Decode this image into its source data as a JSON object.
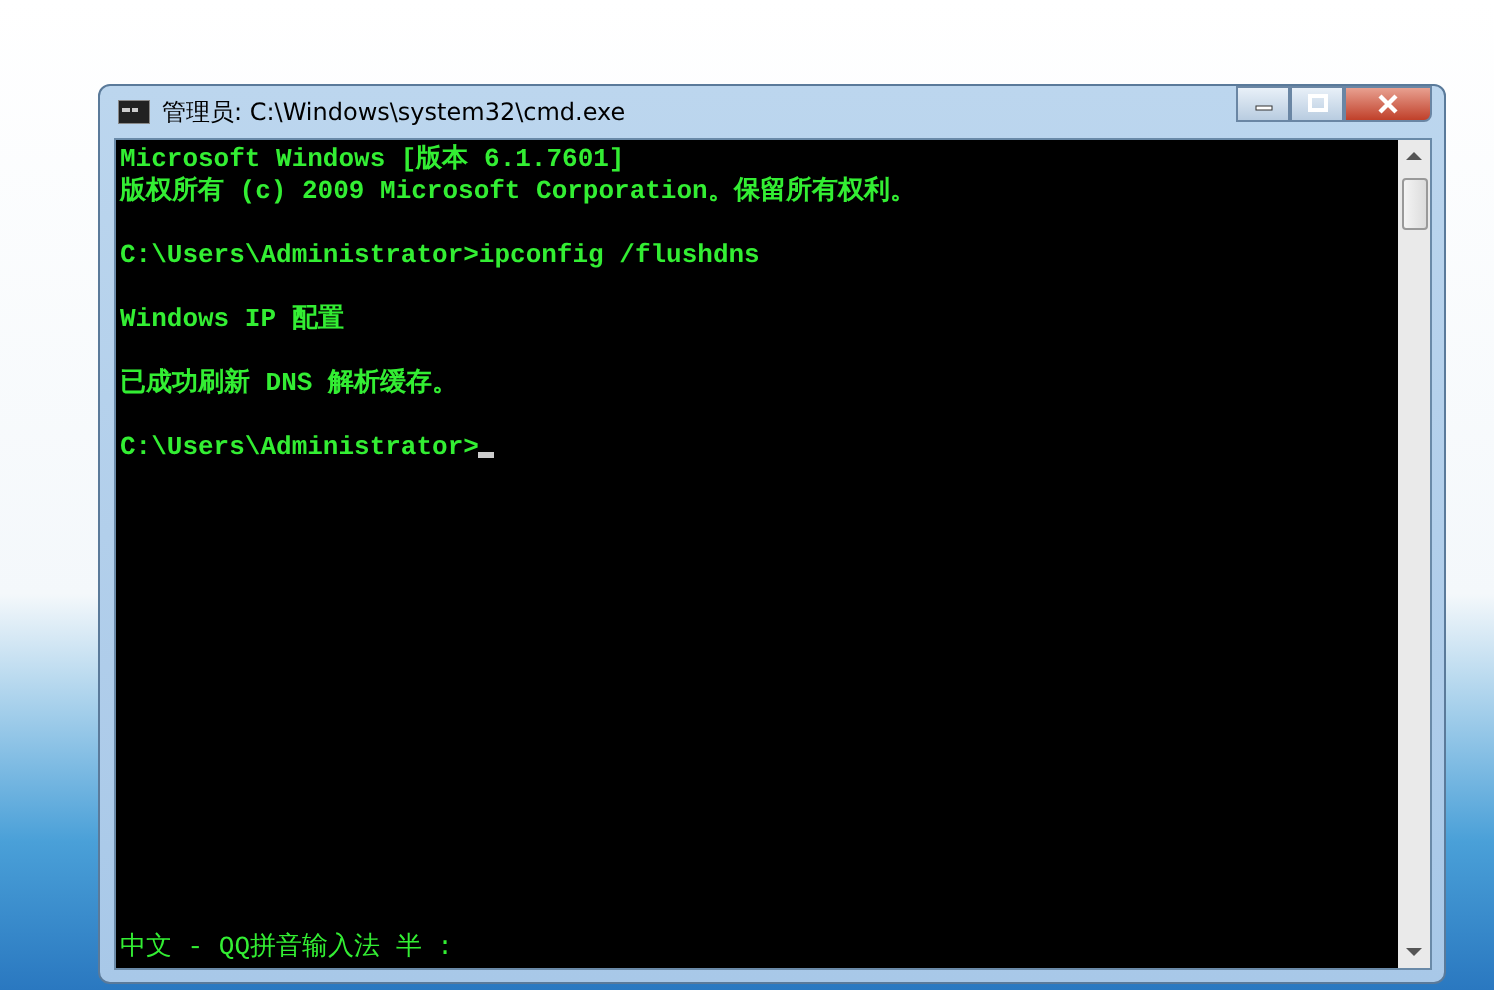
{
  "window": {
    "title": "管理员: C:\\Windows\\system32\\cmd.exe"
  },
  "console": {
    "blocks": [
      {
        "lines": [
          {
            "text": "Microsoft Windows [版本 6.1.7601]",
            "cursor": false
          },
          {
            "text": "版权所有 (c) 2009 Microsoft Corporation。保留所有权利。",
            "cursor": false
          }
        ]
      },
      {
        "lines": [
          {
            "text": "C:\\Users\\Administrator>ipconfig /flushdns",
            "cursor": false
          }
        ]
      },
      {
        "lines": [
          {
            "text": "Windows IP 配置",
            "cursor": false
          }
        ]
      },
      {
        "lines": [
          {
            "text": "已成功刷新 DNS 解析缓存。",
            "cursor": false
          }
        ]
      },
      {
        "lines": [
          {
            "text": "C:\\Users\\Administrator>",
            "cursor": true
          }
        ]
      }
    ],
    "ime_status": "中文 - QQ拼音输入法 半 :"
  }
}
